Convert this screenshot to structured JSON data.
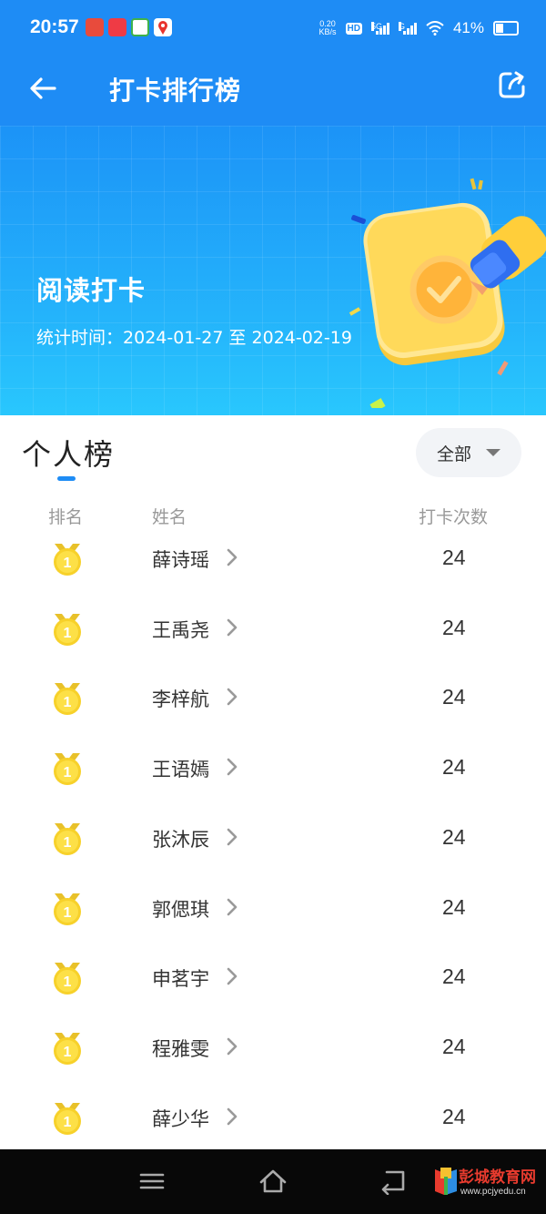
{
  "status_bar": {
    "time": "20:57",
    "net_speed_value": "0.20",
    "net_speed_unit": "KB/s",
    "hd_badge": "HD",
    "network_1": "5G",
    "network_2": "G",
    "battery": "41%",
    "battery_level": 0.41
  },
  "header": {
    "title": "打卡排行榜",
    "back_icon": "arrow-left-icon",
    "share_icon": "share-icon"
  },
  "banner": {
    "title": "阅读打卡",
    "period_label": "统计时间：",
    "period": "2024-01-27 至 2024-02-19"
  },
  "ranking": {
    "section_title": "个人榜",
    "filter_label": "全部",
    "columns": {
      "rank": "排名",
      "name": "姓名",
      "count": "打卡次数"
    },
    "rows": [
      {
        "rank": "1",
        "name": "薛诗瑶",
        "count": "24"
      },
      {
        "rank": "1",
        "name": "王禹尧",
        "count": "24"
      },
      {
        "rank": "1",
        "name": "李梓航",
        "count": "24"
      },
      {
        "rank": "1",
        "name": "王语嫣",
        "count": "24"
      },
      {
        "rank": "1",
        "name": "张沐辰",
        "count": "24"
      },
      {
        "rank": "1",
        "name": "郭偲琪",
        "count": "24"
      },
      {
        "rank": "1",
        "name": "申茗宇",
        "count": "24"
      },
      {
        "rank": "1",
        "name": "程雅雯",
        "count": "24"
      },
      {
        "rank": "1",
        "name": "薛少华",
        "count": "24"
      }
    ]
  },
  "nav_bar": {
    "menu_icon": "menu-icon",
    "home_icon": "home-icon",
    "back_icon": "back-icon"
  },
  "watermark": {
    "text": "彭城教育网",
    "url": "www.pcjyedu.cn"
  },
  "colors": {
    "primary": "#1e8cf5",
    "banner_end": "#29c7fd",
    "medal_gold": "#f7d12a"
  }
}
